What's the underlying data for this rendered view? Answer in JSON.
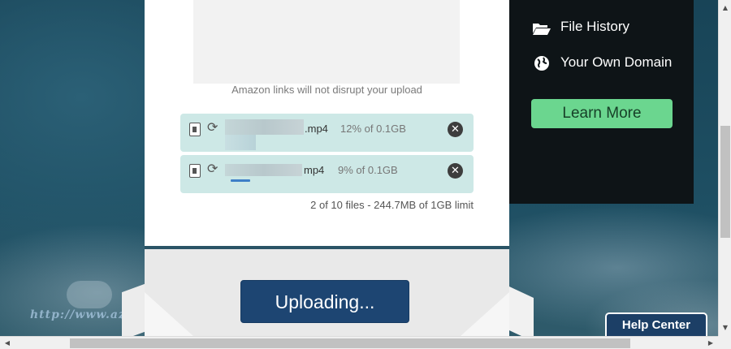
{
  "upload_card": {
    "ad_note": "Amazon links will not disrupt your upload",
    "files": [
      {
        "ext": ".mp4",
        "progress": "12% of 0.1GB",
        "progress_pct": 12
      },
      {
        "ext": "mp4",
        "progress": "9% of 0.1GB",
        "progress_pct": 9
      }
    ],
    "file_count": "2 of 10 files - 244.7MB of 1GB limit",
    "upload_button": "Uploading..."
  },
  "promo": {
    "items": [
      {
        "label": "File History",
        "icon": "folder-open-icon"
      },
      {
        "label": "Your Own Domain",
        "icon": "globe-icon"
      }
    ],
    "learn_more": "Learn More",
    "accent": "#6bd68f"
  },
  "help_center": "Help Center",
  "watermark": "http://www.azocrossing.tw/",
  "colors": {
    "file_row_bg": "#cde8e6",
    "upload_button_bg": "#1d4572",
    "promo_bg": "#0e1417"
  }
}
